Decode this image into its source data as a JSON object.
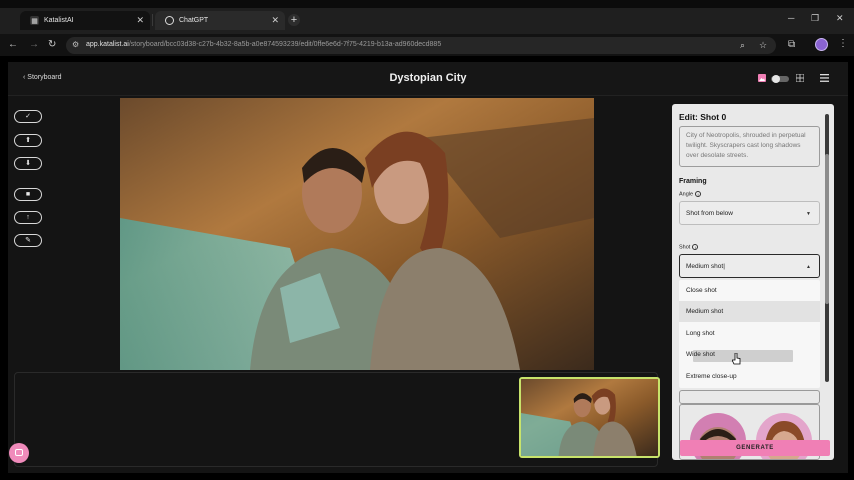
{
  "browser": {
    "tabs": [
      {
        "title": "KatalistAI",
        "active": true
      },
      {
        "title": "ChatGPT",
        "active": false
      }
    ],
    "url_host": "app.katalist.ai",
    "url_path": "/storyboard/bcc03d38-c27b-4b32-8a5b-a0e874593239/edit/0ffe6e6d-7f75-4219-b13a-ad960decd885"
  },
  "header": {
    "back_label": "Storyboard",
    "title": "Dystopian City"
  },
  "editor": {
    "title": "Edit: Shot 0",
    "description": "City of Neotropolis, shrouded in perpetual twilight. Skyscrapers cast long shadows over desolate streets.",
    "section_framing": "Framing",
    "angle_label": "Angle",
    "angle_value": "Shot from below",
    "shot_label": "Shot",
    "shot_value": "Medium shot",
    "shot_options": [
      "Close shot",
      "Medium shot",
      "Long shot",
      "Wide shot",
      "Extreme close-up"
    ],
    "generate_label": "GENERATE"
  },
  "colors": {
    "accent_pink": "#f07fb5",
    "thumb_border": "#c8e36b"
  }
}
